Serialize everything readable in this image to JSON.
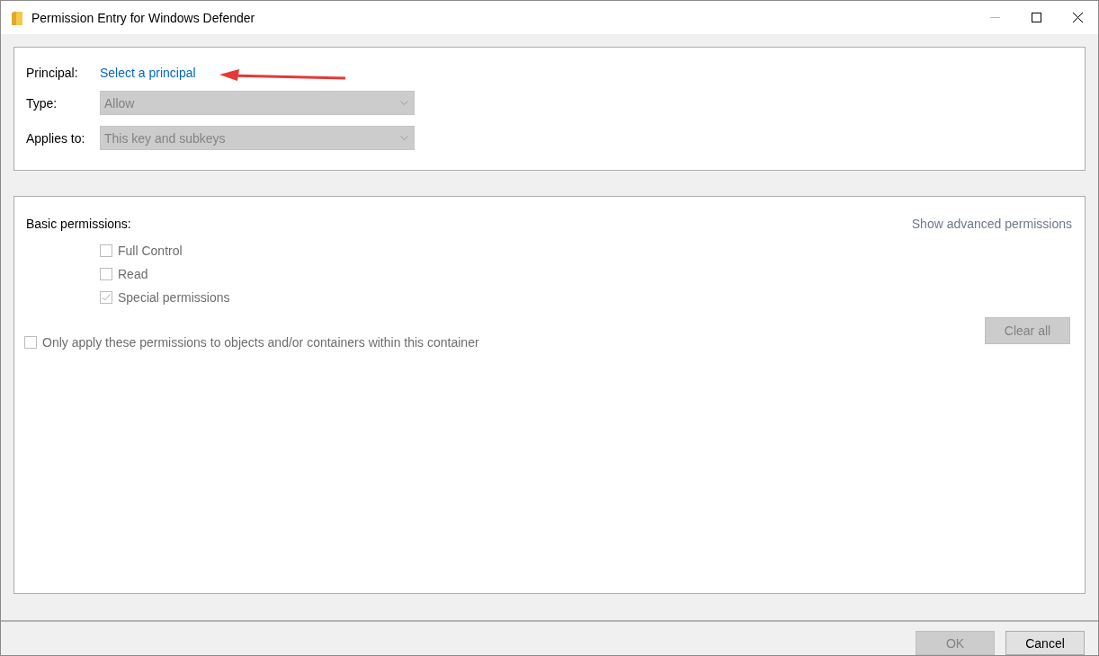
{
  "window": {
    "title": "Permission Entry for Windows Defender",
    "controls": [
      {
        "kind": "minimize",
        "disabled": true
      },
      {
        "kind": "maximize",
        "disabled": false
      },
      {
        "kind": "close",
        "disabled": false
      }
    ]
  },
  "principal": {
    "label": "Principal:",
    "link": "Select a principal"
  },
  "fields": [
    {
      "label": "Type:",
      "value": "Allow",
      "disabled": true
    },
    {
      "label": "Applies to:",
      "value": "This key and subkeys",
      "disabled": true
    }
  ],
  "permissions": {
    "heading": "Basic permissions:",
    "advanced_link": "Show advanced permissions",
    "items": [
      {
        "label": "Full Control",
        "checked": false,
        "disabled": true
      },
      {
        "label": "Read",
        "checked": false,
        "disabled": true
      },
      {
        "label": "Special permissions",
        "checked": true,
        "disabled": true
      }
    ],
    "apply_option": {
      "label": "Only apply these permissions to objects and/or containers within this container",
      "checked": false,
      "disabled": true
    },
    "clear_button": {
      "label": "Clear all",
      "disabled": true
    }
  },
  "buttons": [
    {
      "label": "OK",
      "disabled": true
    },
    {
      "label": "Cancel",
      "disabled": false
    }
  ]
}
